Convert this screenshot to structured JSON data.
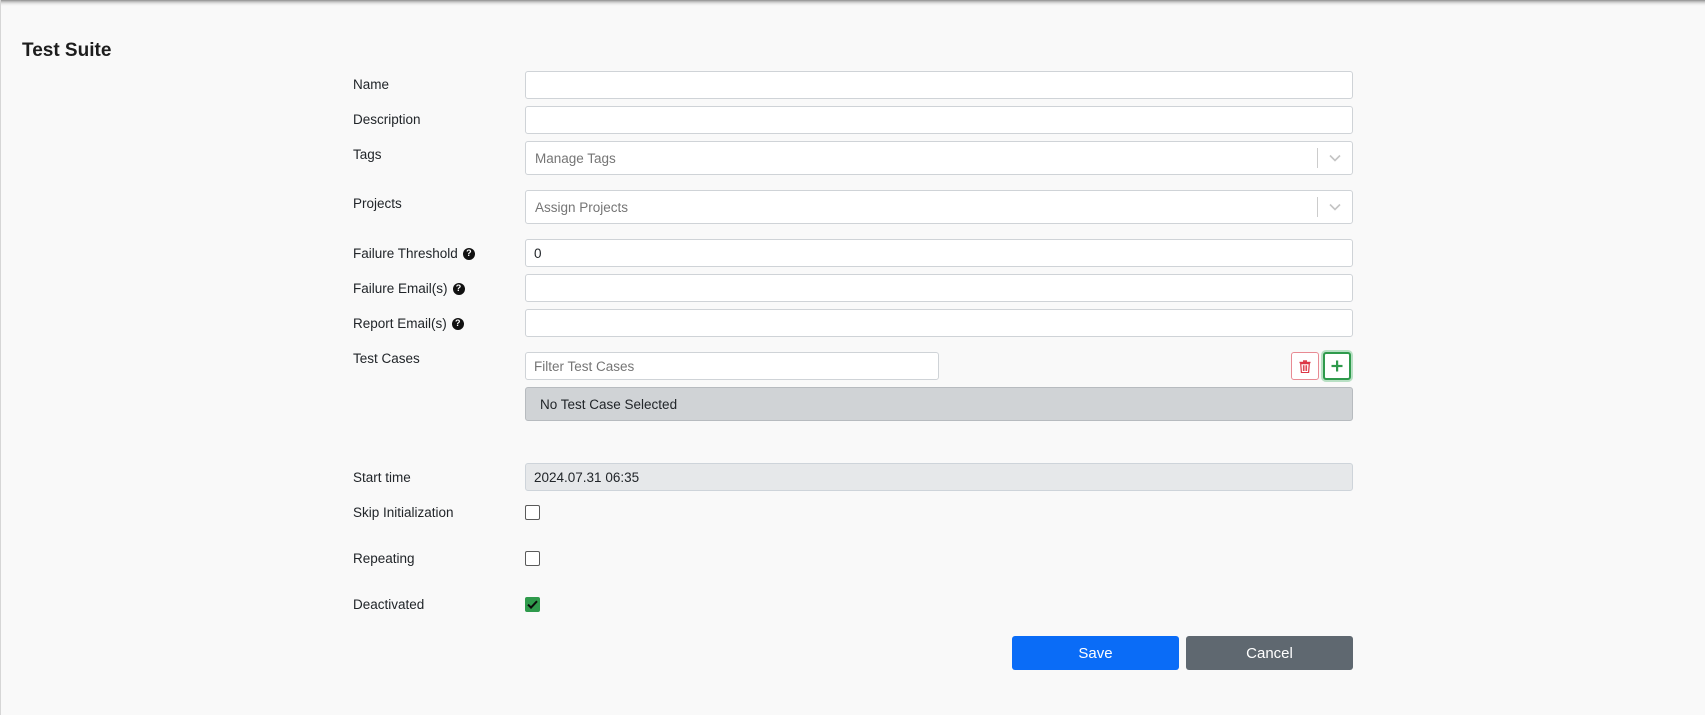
{
  "page": {
    "title": "Test Suite"
  },
  "form": {
    "name": {
      "label": "Name",
      "value": ""
    },
    "description": {
      "label": "Description",
      "value": ""
    },
    "tags": {
      "label": "Tags",
      "placeholder": "Manage Tags"
    },
    "projects": {
      "label": "Projects",
      "placeholder": "Assign Projects"
    },
    "failure_threshold": {
      "label": "Failure Threshold",
      "value": "0"
    },
    "failure_emails": {
      "label": "Failure Email(s)",
      "value": ""
    },
    "report_emails": {
      "label": "Report Email(s)",
      "value": ""
    },
    "test_cases": {
      "label": "Test Cases",
      "filter_placeholder": "Filter Test Cases",
      "empty_text": "No Test Case Selected"
    },
    "start_time": {
      "label": "Start time",
      "value": "2024.07.31 06:35"
    },
    "skip_initialization": {
      "label": "Skip Initialization",
      "checked": false
    },
    "repeating": {
      "label": "Repeating",
      "checked": false
    },
    "deactivated": {
      "label": "Deactivated",
      "checked": true
    }
  },
  "actions": {
    "save_label": "Save",
    "cancel_label": "Cancel"
  },
  "icons": {
    "help": "question-circle-icon",
    "delete": "trash-icon",
    "add": "plus-icon",
    "dropdown": "chevron-down-icon",
    "check": "check-icon"
  },
  "colors": {
    "primary": "#0a6cf7",
    "secondary": "#5f6870",
    "success": "#2f9a4c",
    "danger": "#dc3545"
  }
}
